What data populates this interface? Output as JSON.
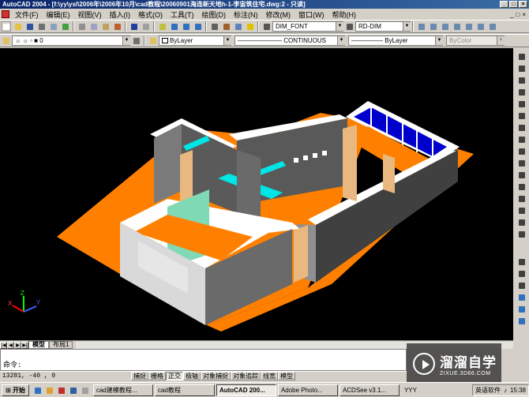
{
  "window": {
    "title": "AutoCAD 2004 - [f:\\yy\\ysl\\2006年\\2006年10月\\cad教程\\20060901海连新天地h-1-李宙筑住宅.dwg:2 - 只读]",
    "buttons": [
      "_",
      "□",
      "×"
    ]
  },
  "menu": {
    "items": [
      "文件(F)",
      "编辑(E)",
      "视图(V)",
      "插入(I)",
      "格式(O)",
      "工具(T)",
      "绘图(D)",
      "标注(N)",
      "修改(M)",
      "窗口(W)",
      "帮助(H)"
    ],
    "window_controls": [
      "_",
      "□",
      "×"
    ]
  },
  "toolbar1": {
    "dimstyle": "DIM_FONT",
    "tablestyle": "RD-DIM"
  },
  "toolbar2": {
    "layer": "0",
    "color": "ByLayer",
    "linetype": "CONTINUOUS",
    "lineweight": "ByLayer",
    "plotstyle": "ByColor"
  },
  "tabs": {
    "nav": [
      "|◀",
      "◀",
      "▶",
      "▶|"
    ],
    "model": "模型",
    "layout": "布局1"
  },
  "command": {
    "prompt": "命令:"
  },
  "status": {
    "coords": "13281, -40 , 0",
    "buttons": [
      {
        "label": "捕捉",
        "on": false
      },
      {
        "label": "栅格",
        "on": false
      },
      {
        "label": "正交",
        "on": true
      },
      {
        "label": "极轴",
        "on": false
      },
      {
        "label": "对象捕捉",
        "on": false
      },
      {
        "label": "对象追踪",
        "on": false
      },
      {
        "label": "线宽",
        "on": false
      },
      {
        "label": "模型",
        "on": false
      }
    ]
  },
  "watermark": {
    "title": "溜溜自学",
    "url": "ZIXUE.3D66.COM"
  },
  "taskbar": {
    "start": "开始",
    "tasks": [
      {
        "label": "cad建模教程...",
        "active": false
      },
      {
        "label": "cad教程",
        "active": false
      },
      {
        "label": "AutoCAD 200...",
        "active": true
      },
      {
        "label": "Adobe Photo...",
        "active": false
      },
      {
        "label": "ACDSee v3.1...",
        "active": false
      }
    ],
    "ime": "YYY",
    "input_method": "英语软件",
    "clock": "15:38"
  },
  "colors": {
    "floor": "#ff8000",
    "wall_top": "#ffffff",
    "wall_side": "#808080",
    "wall_dark": "#404040",
    "beam": "#00e5e5",
    "window_glass": "#0000cc",
    "door": "#e8b880",
    "glass_panel": "#7fd9b5"
  },
  "icons": {
    "toolbar1": [
      "new-icon",
      "open-icon",
      "save-icon",
      "print-icon",
      "preview-icon",
      "publish-icon",
      "cut-icon",
      "copy-icon",
      "paste-icon",
      "matchprop-icon",
      "undo-icon",
      "redo-icon",
      "pan-icon",
      "zoom-realtime-icon",
      "zoom-window-icon",
      "zoom-previous-icon",
      "properties-icon",
      "designcenter-icon",
      "toolpalette-icon",
      "help-icon"
    ],
    "right": [
      "line-icon",
      "construction-line-icon",
      "polyline-icon",
      "polygon-icon",
      "rectangle-icon",
      "arc-icon",
      "circle-icon",
      "revcloud-icon",
      "spline-icon",
      "ellipse-icon",
      "insert-block-icon",
      "make-block-icon",
      "point-icon",
      "hatch-icon",
      "region-icon",
      "mtext-icon"
    ]
  }
}
